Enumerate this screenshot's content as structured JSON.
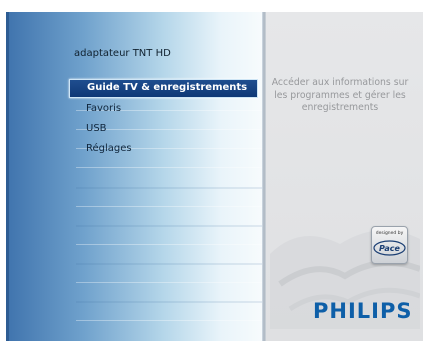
{
  "device_title": "adaptateur TNT HD",
  "menu": {
    "items": [
      {
        "label": "Guide TV & enregistrements",
        "selected": true
      },
      {
        "label": "Favoris",
        "selected": false
      },
      {
        "label": "USB",
        "selected": false
      },
      {
        "label": "Réglages",
        "selected": false
      }
    ]
  },
  "description": "Accéder aux informations sur les programmes et gérer les enregistrements",
  "badge": {
    "top_text": "designed by",
    "logo_text": "Pace"
  },
  "brand": "PHILIPS",
  "colors": {
    "selected_bg": "#1a4689",
    "brand_blue": "#0e5fa8",
    "panel_blue": "#6fa1cc",
    "description_text": "#97999c"
  }
}
